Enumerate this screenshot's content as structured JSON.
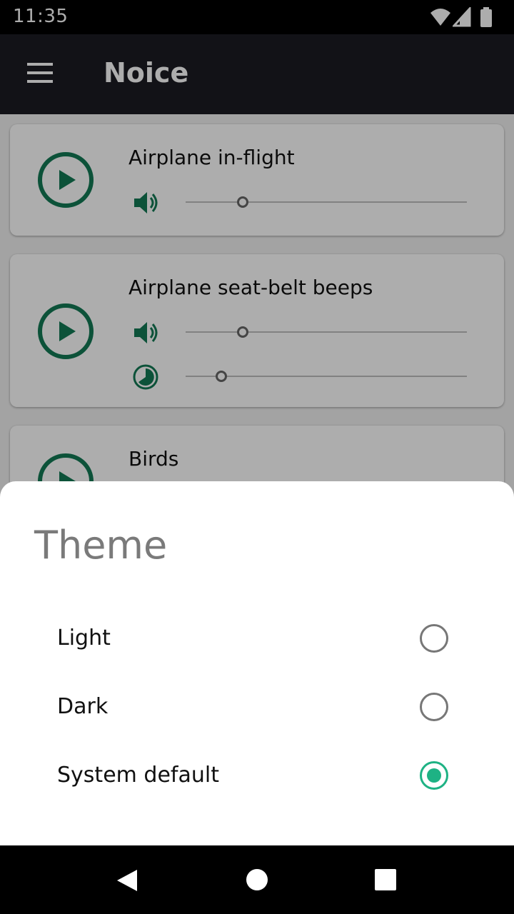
{
  "status_bar": {
    "time": "11:35"
  },
  "app_bar": {
    "title": "Noice"
  },
  "sounds": [
    {
      "title": "Airplane in-flight",
      "volume": 0.2
    },
    {
      "title": "Airplane seat-belt beeps",
      "volume": 0.2,
      "time_period": 0.12
    },
    {
      "title": "Birds"
    }
  ],
  "dialog": {
    "title": "Theme",
    "options": [
      {
        "label": "Light",
        "selected": false
      },
      {
        "label": "Dark",
        "selected": false
      },
      {
        "label": "System default",
        "selected": true
      }
    ]
  },
  "colors": {
    "accent": "#1eb284",
    "play_icon": "#137a55"
  }
}
